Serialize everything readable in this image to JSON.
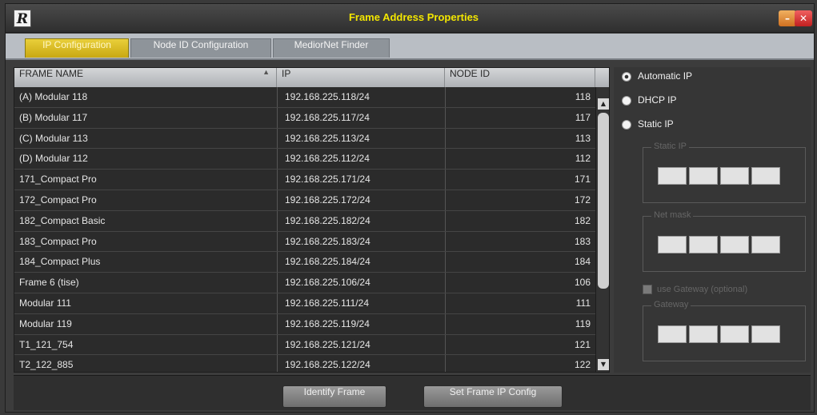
{
  "window": {
    "logo": "R",
    "title": "Frame Address Properties",
    "minimize_glyph": "–",
    "close_glyph": "✕"
  },
  "tabs": [
    {
      "label": "IP Configuration",
      "active": true
    },
    {
      "label": "Node ID Configuration",
      "active": false
    },
    {
      "label": "MediorNet Finder",
      "active": false
    }
  ],
  "table": {
    "columns": [
      "FRAME NAME",
      "IP",
      "NODE ID"
    ],
    "sort_glyph": "▲",
    "rows": [
      {
        "name": "(A) Modular 118",
        "ip": "192.168.225.118/24",
        "node": "118"
      },
      {
        "name": "(B) Modular 117",
        "ip": "192.168.225.117/24",
        "node": "117"
      },
      {
        "name": "(C) Modular 113",
        "ip": "192.168.225.113/24",
        "node": "113"
      },
      {
        "name": "(D) Modular 112",
        "ip": "192.168.225.112/24",
        "node": "112"
      },
      {
        "name": "171_Compact Pro",
        "ip": "192.168.225.171/24",
        "node": "171"
      },
      {
        "name": "172_Compact Pro",
        "ip": "192.168.225.172/24",
        "node": "172"
      },
      {
        "name": "182_Compact Basic",
        "ip": "192.168.225.182/24",
        "node": "182"
      },
      {
        "name": "183_Compact Pro",
        "ip": "192.168.225.183/24",
        "node": "183"
      },
      {
        "name": "184_Compact Plus",
        "ip": "192.168.225.184/24",
        "node": "184"
      },
      {
        "name": "Frame 6 (tise)",
        "ip": "192.168.225.106/24",
        "node": "106"
      },
      {
        "name": "Modular 111",
        "ip": "192.168.225.111/24",
        "node": "111"
      },
      {
        "name": "Modular 119",
        "ip": "192.168.225.119/24",
        "node": "119"
      },
      {
        "name": "T1_121_754",
        "ip": "192.168.225.121/24",
        "node": "121"
      },
      {
        "name": "T2_122_885",
        "ip": "192.168.225.122/24",
        "node": "122"
      }
    ]
  },
  "ip_mode": {
    "options": [
      "Automatic IP",
      "DHCP IP",
      "Static IP"
    ],
    "selected": "Automatic IP"
  },
  "static_group": {
    "static_ip_label": "Static IP",
    "net_mask_label": "Net mask",
    "use_gateway_label": "use Gateway (optional)",
    "gateway_label": "Gateway"
  },
  "footer": {
    "identify_label": "Identify Frame",
    "set_label": "Set Frame IP Config"
  }
}
